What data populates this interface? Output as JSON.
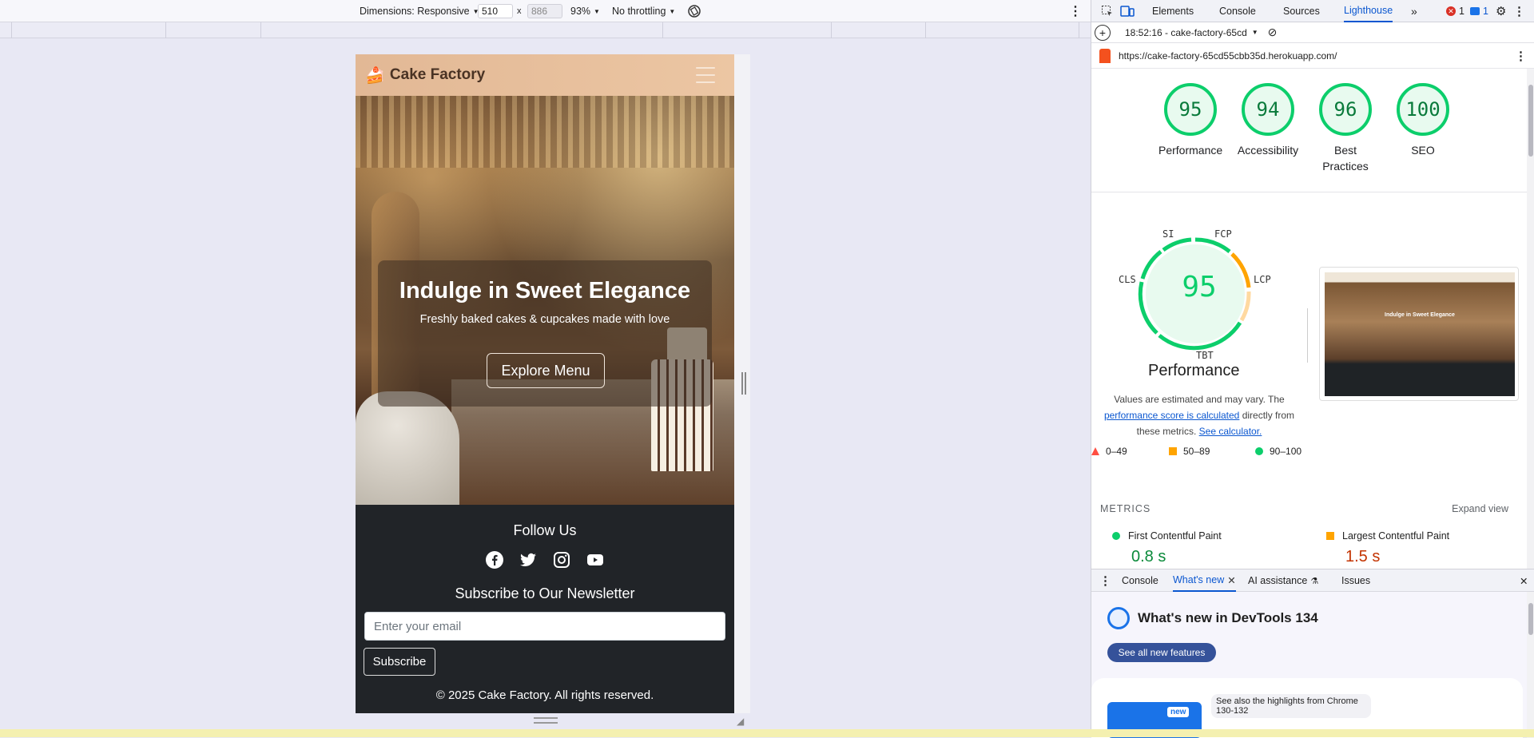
{
  "toolbar": {
    "dimensions_label": "Dimensions: Responsive",
    "width": "510",
    "times": "x",
    "height": "886",
    "zoom": "93%",
    "throttling": "No throttling"
  },
  "site": {
    "brand": "Cake Factory",
    "logo_glyph": "🍰",
    "hero_title": "Indulge in Sweet Elegance",
    "hero_subtitle": "Freshly baked cakes & cupcakes made with love",
    "hero_button": "Explore Menu",
    "follow_title": "Follow Us",
    "newsletter_title": "Subscribe to Our Newsletter",
    "email_placeholder": "Enter your email",
    "subscribe_label": "Subscribe",
    "copyright": "© 2025 Cake Factory. All rights reserved.",
    "social_icons": [
      "facebook-icon",
      "twitter-icon",
      "instagram-icon",
      "youtube-icon"
    ]
  },
  "devtools": {
    "tabs": [
      "Elements",
      "Console",
      "Sources",
      "Lighthouse"
    ],
    "active_tab": "Lighthouse",
    "errors_count": "1",
    "messages_count": "1",
    "report_time": "18:52:16 - cake-factory-65cd",
    "url": "https://cake-factory-65cd55cbb35d.herokuapp.com/",
    "scores": [
      {
        "label": "Performance",
        "value": "95"
      },
      {
        "label": "Accessibility",
        "value": "94"
      },
      {
        "label": "Best Practices",
        "value": "96"
      },
      {
        "label": "SEO",
        "value": "100"
      }
    ],
    "perf_score": "95",
    "perf_title": "Performance",
    "metric_abbrs": {
      "si": "SI",
      "fcp": "FCP",
      "cls": "CLS",
      "lcp": "LCP",
      "tbt": "TBT"
    },
    "values_text_1": "Values are estimated and may vary. The",
    "values_link_1": "performance score is calculated",
    "values_text_2": "directly from these metrics.",
    "values_link_2": "See calculator.",
    "thumb_title": "Indulge in Sweet Elegance",
    "legend": [
      {
        "range": "0–49",
        "color": "#ff4e42"
      },
      {
        "range": "50–89",
        "color": "#ffa400"
      },
      {
        "range": "90–100",
        "color": "#0cce6b"
      }
    ],
    "metrics_label": "METRICS",
    "expand_view": "Expand view",
    "metrics": [
      {
        "name": "First Contentful Paint",
        "value": "0.8 s",
        "color": "#0cce6b"
      },
      {
        "name": "Largest Contentful Paint",
        "value": "1.5 s",
        "color": "#ffa400"
      }
    ]
  },
  "drawer": {
    "tabs": [
      "Console",
      "What's new",
      "AI assistance",
      "Issues"
    ],
    "active_tab": "What's new",
    "whats_new_title": "What's new in DevTools 134",
    "see_all": "See all new features",
    "highlight_badge": "new",
    "highlight_text": "See also the highlights from Chrome 130-132"
  }
}
